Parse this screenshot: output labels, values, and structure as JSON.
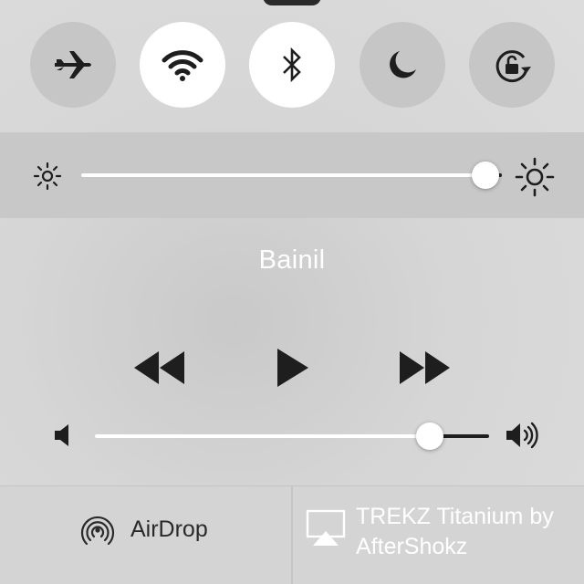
{
  "toggles": [
    {
      "name": "airplane-mode",
      "icon": "airplane-icon",
      "on": false
    },
    {
      "name": "wifi",
      "icon": "wifi-icon",
      "on": true
    },
    {
      "name": "bluetooth",
      "icon": "bluetooth-icon",
      "on": true
    },
    {
      "name": "do-not-disturb",
      "icon": "moon-icon",
      "on": false
    },
    {
      "name": "rotation-lock",
      "icon": "rotation-lock-icon",
      "on": false
    }
  ],
  "brightness": {
    "level": 0.96,
    "min_icon": "sun-small-icon",
    "max_icon": "sun-large-icon"
  },
  "now_playing": {
    "title": "Bainil",
    "controls": [
      "rewind-icon",
      "play-icon",
      "fast-forward-icon"
    ]
  },
  "volume": {
    "level": 0.85,
    "min_icon": "speaker-low-icon",
    "max_icon": "speaker-high-icon"
  },
  "airdrop": {
    "label": "AirDrop",
    "icon": "airdrop-icon"
  },
  "airplay": {
    "label": "TREKZ Titanium by AfterShokz",
    "icon": "airplay-icon"
  },
  "colors": {
    "toggle_on": "#ffffff",
    "toggle_off": "#c6c6c6",
    "icon": "#1e1e1e",
    "title_text": "#ffffff"
  }
}
